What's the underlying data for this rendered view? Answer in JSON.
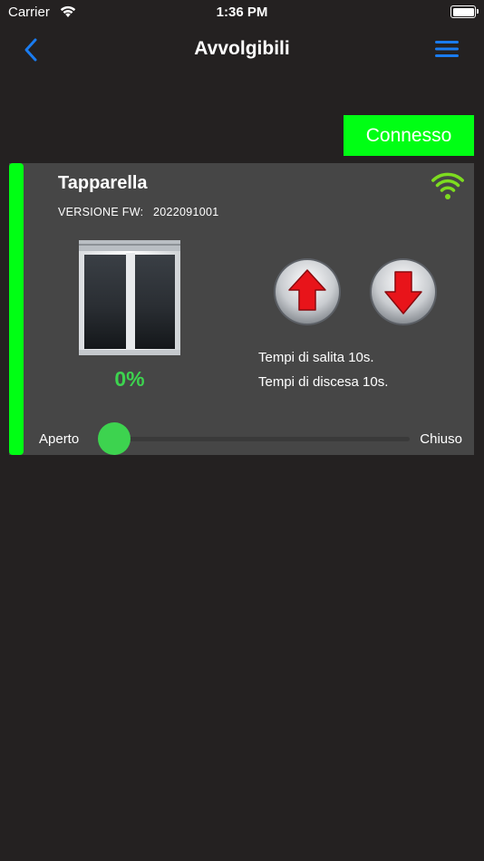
{
  "status_bar": {
    "carrier": "Carrier",
    "time": "1:36 PM"
  },
  "nav": {
    "title": "Avvolgibili",
    "back_icon": "chevron-left-icon",
    "menu_icon": "hamburger-menu-icon"
  },
  "connection": {
    "label": "Connesso"
  },
  "device": {
    "name": "Tapparella",
    "fw_label": "VERSIONE FW:",
    "fw_value": "2022091001",
    "position_percent": "0%",
    "position_value": 0,
    "rise_time": "Tempi di salita 10s.",
    "fall_time": "Tempi di discesa 10s.",
    "slider_min_label": "Aperto",
    "slider_max_label": "Chiuso",
    "signal_icon": "wifi-signal-icon",
    "up_icon": "arrow-up-icon",
    "down_icon": "arrow-down-icon"
  },
  "colors": {
    "background": "#242121",
    "card": "#464646",
    "accent_green": "#00ff14",
    "percent_green": "#3dd34f",
    "nav_blue": "#1a7cf0",
    "arrow_red": "#e8141a"
  }
}
